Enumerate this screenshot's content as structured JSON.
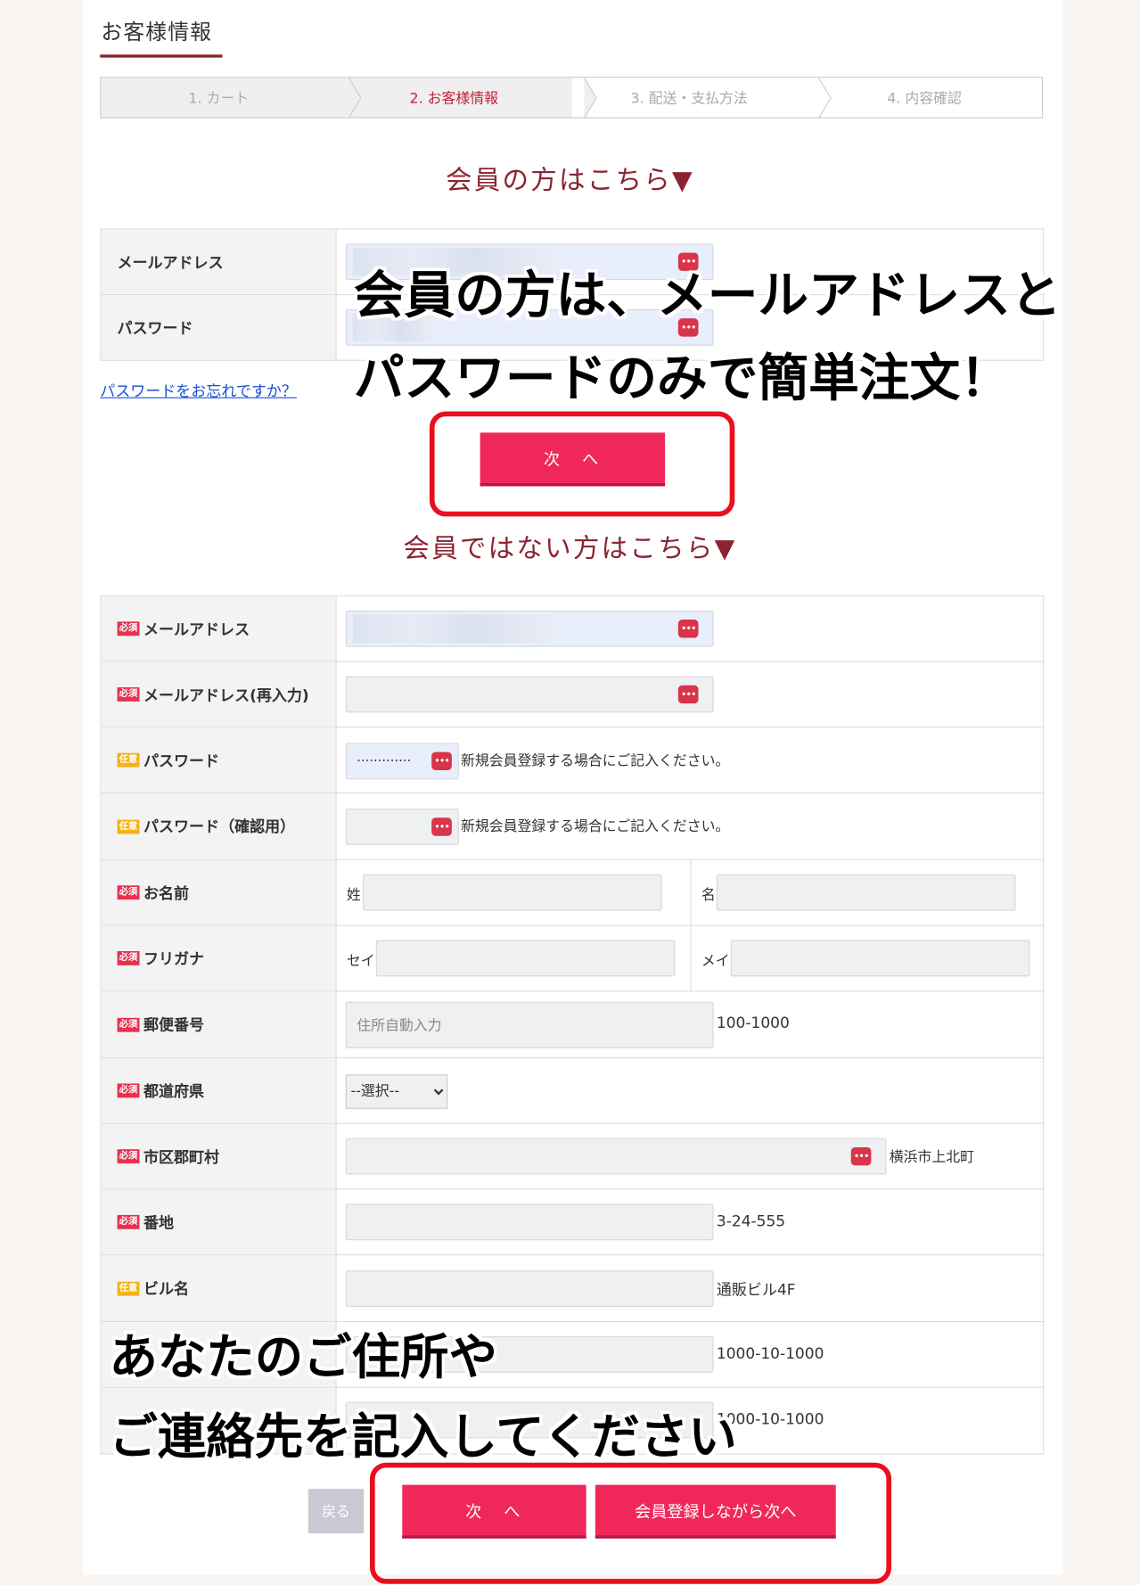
{
  "page_title": "お客様情報",
  "steps": [
    {
      "label": "1. カート",
      "state": "done"
    },
    {
      "label": "2. お客様情報",
      "state": "active"
    },
    {
      "label": "3. 配送・支払方法",
      "state": "pending"
    },
    {
      "label": "4. 内容確認",
      "state": "pending"
    }
  ],
  "member": {
    "heading": "会員の方はこちら▼",
    "email_label": "メールアドレス",
    "password_label": "パスワード",
    "forgot_link": "パスワードをお忘れですか？",
    "next_button": "次　へ"
  },
  "guest": {
    "heading": "会員ではない方はこちら▼",
    "badge_required": "必須",
    "badge_optional": "任意",
    "email_label": "メールアドレス",
    "email_confirm_label": "メールアドレス(再入力)",
    "password_label": "パスワード",
    "password_value": "·············",
    "password_hint": "新規会員登録する場合にご記入ください。",
    "password_confirm_label": "パスワード（確認用）",
    "password_confirm_hint": "新規会員登録する場合にご記入ください。",
    "name_label": "お名前",
    "last_name": "姓",
    "first_name": "名",
    "kana_label": "フリガナ",
    "last_kana": "セイ",
    "first_kana": "メイ",
    "zip_label": "郵便番号",
    "zip_placeholder": "住所自動入力",
    "zip_example": "100-1000",
    "pref_label": "都道府県",
    "pref_selected": "--選択--",
    "city_label": "市区郡町村",
    "city_example": "横浜市上北町",
    "street_label": "番地",
    "street_example": "3-24-555",
    "building_label": "ビル名",
    "building_example": "通販ビル4F",
    "phone_example": "1000-10-1000",
    "extra_example": "1000-10-1000"
  },
  "buttons": {
    "back": "戻る",
    "next": "次　へ",
    "register_next": "会員登録しながら次へ"
  },
  "overlays": {
    "member_line1": "会員の方は、メールアドレスと",
    "member_line2": "パスワードのみで簡単注文！",
    "guest_line1": "あなたのご住所や",
    "guest_line2": "ご連絡先を記入してください"
  },
  "key_icon": "•••",
  "colors": {
    "accent": "#8a2332",
    "button": "#f0285a",
    "frame": "#e8101e"
  }
}
